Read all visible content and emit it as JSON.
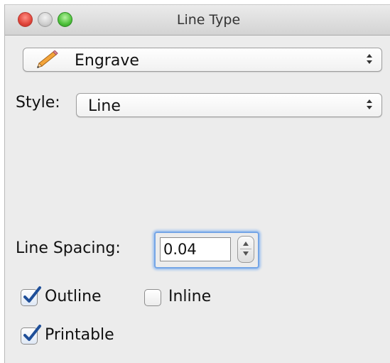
{
  "window": {
    "title": "Line Type"
  },
  "tool_popup": {
    "value": "Engrave",
    "icon": "pencil-icon"
  },
  "style": {
    "label": "Style:",
    "value": "Line"
  },
  "spacing": {
    "label": "Line Spacing:",
    "value": "0.04"
  },
  "checkboxes": {
    "outline": {
      "label": "Outline",
      "checked": true
    },
    "inline": {
      "label": "Inline",
      "checked": false
    },
    "printable": {
      "label": "Printable",
      "checked": true
    }
  },
  "colors": {
    "focus_ring": "#74a5e6",
    "check": "#1f4f99",
    "window_bg": "#ececec"
  }
}
